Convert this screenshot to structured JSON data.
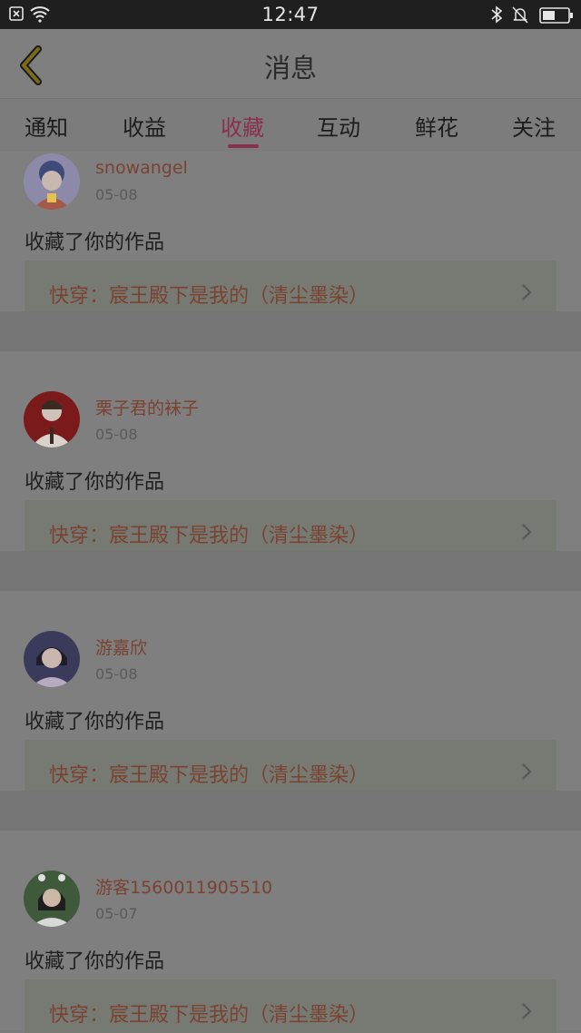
{
  "status_bar": {
    "time": "12:47",
    "icons": [
      "notification-x-icon",
      "wifi-icon",
      "bluetooth-icon",
      "mute-bell-icon",
      "battery-icon"
    ]
  },
  "header": {
    "title": "消息",
    "back_icon": "chevron-left-icon"
  },
  "tabs": [
    {
      "label": "通知",
      "active": false
    },
    {
      "label": "收益",
      "active": false
    },
    {
      "label": "收藏",
      "active": true
    },
    {
      "label": "互动",
      "active": false
    },
    {
      "label": "鲜花",
      "active": false
    },
    {
      "label": "关注",
      "active": false
    }
  ],
  "messages": [
    {
      "username": "snowangel",
      "date": "05-08",
      "action": "收藏了你的作品",
      "work_title": "快穿：宸王殿下是我的（清尘墨染）"
    },
    {
      "username": "栗子君的袜子",
      "date": "05-08",
      "action": "收藏了你的作品",
      "work_title": "快穿：宸王殿下是我的（清尘墨染）"
    },
    {
      "username": "游嘉欣",
      "date": "05-08",
      "action": "收藏了你的作品",
      "work_title": "快穿：宸王殿下是我的（清尘墨染）"
    },
    {
      "username": "游客1560011905510",
      "date": "05-07",
      "action": "收藏了你的作品",
      "work_title": "快穿：宸王殿下是我的（清尘墨染）"
    }
  ],
  "colors": {
    "accent": "#8a2f4d",
    "link": "#7a4230",
    "overlay_bg": "#7f7f7f"
  }
}
